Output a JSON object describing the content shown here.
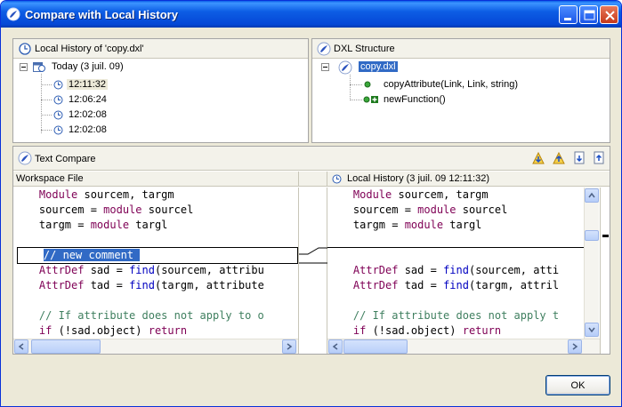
{
  "window": {
    "title": "Compare with Local History",
    "icon": "eclipse-app-icon"
  },
  "titlebar_buttons": [
    {
      "name": "minimize-button",
      "icon": "minimize-icon"
    },
    {
      "name": "maximize-button",
      "icon": "maximize-icon"
    },
    {
      "name": "close-button",
      "icon": "close-icon"
    }
  ],
  "local_history": {
    "title": "Local History of 'copy.dxl'",
    "group_label": "Today (3 juil. 09)",
    "entries": [
      "12:11:32",
      "12:06:24",
      "12:02:08",
      "12:02:08"
    ],
    "selected_index": 0
  },
  "dxl_structure": {
    "title": "DXL Structure",
    "root": "copy.dxl",
    "children": [
      "copyAttribute(Link, Link, string)",
      "newFunction()"
    ]
  },
  "text_compare": {
    "title": "Text Compare",
    "toolbar": [
      "next-difference-icon",
      "previous-difference-icon",
      "next-change-icon",
      "previous-change-icon"
    ],
    "left_header": "Workspace File",
    "right_header": "Local History (3 juil. 09 12:11:32)"
  },
  "left_code": [
    [
      "    ",
      "Module",
      " sourcem, targm"
    ],
    [
      "    sourcem = ",
      "module",
      " sourcel"
    ],
    [
      "    targm = ",
      "module",
      " targl"
    ],
    [
      "",
      "",
      ""
    ],
    [
      "    // new comment",
      "",
      ""
    ],
    [
      "    ",
      "AttrDef",
      " sad = ",
      "find",
      "(sourcem, attribu"
    ],
    [
      "    ",
      "AttrDef",
      " tad = ",
      "find",
      "(targm, attribute"
    ],
    [
      "",
      "",
      ""
    ],
    [
      "    // If attribute does not apply to o",
      "",
      ""
    ],
    [
      "    ",
      "if",
      " (!sad.object) ",
      "return",
      ""
    ]
  ],
  "right_code": [
    [
      "    ",
      "Module",
      " sourcem, targm"
    ],
    [
      "    sourcem = ",
      "module",
      " sourcel"
    ],
    [
      "    targm = ",
      "module",
      " targl"
    ],
    [
      "",
      "",
      ""
    ],
    [
      "    ",
      "AttrDef",
      " sad = ",
      "find",
      "(sourcem, atti"
    ],
    [
      "    ",
      "AttrDef",
      " tad = ",
      "find",
      "(targm, attril"
    ],
    [
      "",
      "",
      ""
    ],
    [
      "    // If attribute does not apply t",
      "",
      ""
    ],
    [
      "    ",
      "if",
      " (!sad.object) ",
      "return",
      ""
    ]
  ],
  "buttons": {
    "ok": "OK"
  }
}
